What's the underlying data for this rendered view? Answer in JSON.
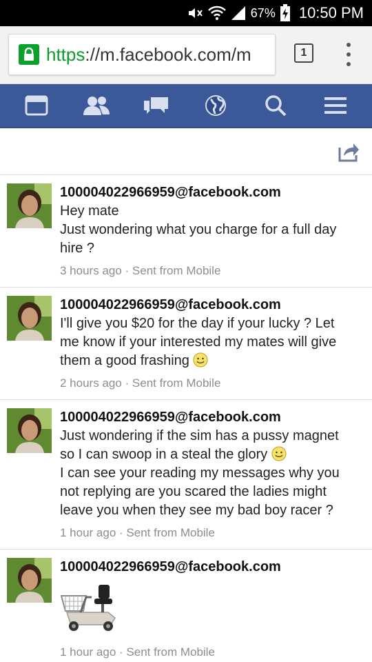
{
  "status_bar": {
    "battery": "67%",
    "time": "10:50 PM"
  },
  "browser": {
    "url_scheme": "https",
    "url_rest": "://m.facebook.com/m",
    "tab_count": "1"
  },
  "messages": [
    {
      "sender": "100004022966959@facebook.com",
      "lines": [
        "Hey mate",
        "Just wondering what you charge for a full day",
        "hire ?"
      ],
      "time": "3 hours ago",
      "via": "Sent from Mobile"
    },
    {
      "sender": "100004022966959@facebook.com",
      "lines": [
        "I'll give you $20 for the day if your lucky ? Let",
        "me know if your interested my mates will give",
        "them a good frashing"
      ],
      "time": "2 hours ago",
      "via": "Sent from Mobile"
    },
    {
      "sender": "100004022966959@facebook.com",
      "lines": [
        "Just wondering if the sim has a pussy magnet",
        "so I can swoop in a steal the glory",
        "I can see your reading my messages why you",
        "not replying are you scared the ladies might",
        "leave you when they see my bad boy racer ?"
      ],
      "time": "1 hour ago",
      "via": "Sent from Mobile"
    },
    {
      "sender": "100004022966959@facebook.com",
      "lines": [],
      "attachment": "mobility-scooter-image",
      "time": "1 hour ago",
      "via": "Sent from Mobile"
    }
  ],
  "colors": {
    "fb_blue": "#3b5998",
    "secure_green": "#0ba12d"
  }
}
